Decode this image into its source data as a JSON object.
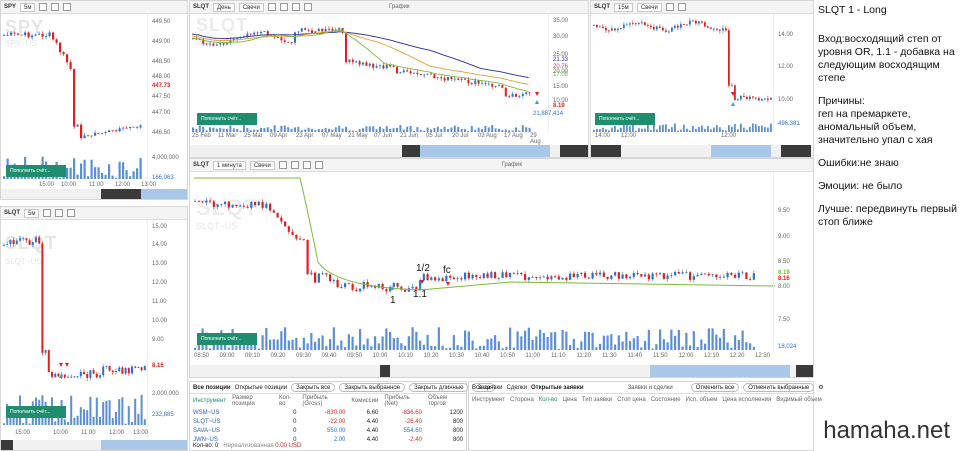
{
  "panels": {
    "spy": {
      "symbol": "SPY",
      "timeframe": "5м",
      "watermark": "SPY",
      "watermark_sub": "SPY~US",
      "y_ticks": [
        "449.50",
        "449.00",
        "448.50",
        "448.00",
        "447.50",
        "447.00",
        "446.50"
      ],
      "price_tag": "447.73",
      "x_ticks": [
        "15:00",
        "10:00",
        "11:00",
        "12:00",
        "13:00"
      ],
      "volume_max": "4,000,000",
      "volume_tag": "166,063",
      "fill_button": "Пополнить счёт..."
    },
    "slqt_day": {
      "symbol": "SLQT",
      "timeframe": "День",
      "chart_type": "Свечи",
      "graph_label": "График",
      "watermark": "SLQT",
      "watermark_sub": "SLQT~US",
      "y_ticks": [
        "35.00",
        "30.00",
        "25.00",
        "20.00",
        "15.00",
        "10.00"
      ],
      "ma_tags": [
        "21.33",
        "20.76",
        "17.08"
      ],
      "price_tag": "8.19",
      "x_ticks": [
        "25 Feb",
        "11 Mar",
        "25 Mar",
        "09 Apr",
        "23 Apr",
        "07 May",
        "21 May",
        "07 Jun",
        "21 Jun",
        "05 Jul",
        "20 Jul",
        "03 Aug",
        "17 Aug",
        "29 Aug"
      ],
      "volume_tag": "21,887,414",
      "fill_button": "Пополнить счёт..."
    },
    "slqt_15m": {
      "symbol": "SLQT",
      "timeframe": "15м",
      "chart_type": "Свечи",
      "y_ticks": [
        "14.00",
        "12.00",
        "10.00"
      ],
      "x_ticks": [
        "14:00",
        "12:00",
        "12:00"
      ],
      "volume_tag": "496,381",
      "fill_button": "Пополнить счёт..."
    },
    "slqt_1m": {
      "symbol": "SLQT",
      "timeframe": "1 минута",
      "chart_type": "Свечи",
      "graph_label": "График",
      "watermark": "SLQT",
      "watermark_sub": "SLQT~US",
      "y_ticks": [
        "9.50",
        "9.00",
        "8.50",
        "8.00"
      ],
      "y_ticks_low": [
        "7.50"
      ],
      "price_tags": [
        "8.19",
        "8.16",
        "8.00"
      ],
      "x_ticks": [
        "08:50",
        "09:00",
        "09:10",
        "09:20",
        "09:30",
        "09:40",
        "09:50",
        "10:00",
        "10:10",
        "10:20",
        "10:30",
        "10:40",
        "10:50",
        "11:00",
        "11:10",
        "11:20",
        "11:30",
        "11:40",
        "11:50",
        "12:00",
        "12:10",
        "12:20",
        "12:30"
      ],
      "volume_tag": "18,024",
      "fill_button": "Пополнить счёт..."
    },
    "slqt_5m": {
      "symbol": "SLQT",
      "timeframe": "5м",
      "watermark": "SLQT",
      "watermark_sub": "SLQT~US",
      "y_ticks": [
        "15.00",
        "14.00",
        "13.00",
        "12.00",
        "11.00",
        "10.00",
        "9.00"
      ],
      "price_tag": "8.16",
      "x_ticks": [
        "15:00",
        "10:00",
        "11:00",
        "12:00",
        "13:00"
      ],
      "volume_max": "2,000,000",
      "volume_tag": "232,885",
      "fill_button": "Пополнить счёт..."
    }
  },
  "annotations": {
    "entry": "1",
    "add": "1.1",
    "half": "1/2",
    "fc": "fc"
  },
  "positions": {
    "tabs": [
      "Все позиции",
      "Открытые позиции"
    ],
    "buttons": [
      "Закрыть все",
      "Закрыть выбранное",
      "Закрыть длинные",
      "Закр"
    ],
    "columns": [
      "Инструмент",
      "Размер позиции",
      "Кол-во",
      "Прибыль (Gross)",
      "Комиссии",
      "Прибыль (Net)",
      "Объем торгов"
    ],
    "rows": [
      {
        "ticker": "WSM~US",
        "size": "",
        "qty": "0",
        "gross": "-830.00",
        "comm": "6.60",
        "net": "-836.60",
        "vol": "1200"
      },
      {
        "ticker": "SLQT~US",
        "size": "",
        "qty": "0",
        "gross": "-22.00",
        "comm": "4.40",
        "net": "-26.40",
        "vol": "800"
      },
      {
        "ticker": "SAVA~US",
        "size": "",
        "qty": "0",
        "gross": "550.00",
        "comm": "4.40",
        "net": "554.60",
        "vol": "800"
      },
      {
        "ticker": "JWN~US",
        "size": "",
        "qty": "0",
        "gross": "2.00",
        "comm": "4.40",
        "net": "-2.40",
        "vol": "800"
      }
    ],
    "footer_label": "Кол-во: 0",
    "footer_unrealized": "Нереализованная",
    "footer_value": "0.00 USD"
  },
  "orders": {
    "tabs": [
      "Все заявки",
      "Сделки",
      "Открытые заявки"
    ],
    "title": "Заявки и сделки",
    "buttons": [
      "Отменить все",
      "Отменить выбранные"
    ],
    "columns": [
      "Инструмент",
      "Сторона",
      "Кол-во",
      "Цена",
      "Тип заявки",
      "Стоп цена",
      "Состояние",
      "Исп. объем",
      "Цена исполнения",
      "Видимый объем"
    ]
  },
  "notes": {
    "title": "SLQT 1 - Long",
    "entry": "Вход:восходящий степ от уровня OR, 1.1 - добавка на следующим восходящим степе",
    "reasons": "Причины:\nгеп на премаркете, аномальный объем, значительно упал с хая",
    "errors": "Ошибки:не знаю",
    "emotions": "Эмоции: не было",
    "better": "Лучше: передвинуть первый стоп ближе"
  },
  "brand": "hamaha.net",
  "colors": {
    "up": "#2f6fd0",
    "down": "#e02020",
    "ma_green": "#7cba3a",
    "ma_orange": "#e0a030",
    "ma_blue": "#2a2aa0",
    "ma_red": "#d04040",
    "accent": "#1e8e6e"
  }
}
